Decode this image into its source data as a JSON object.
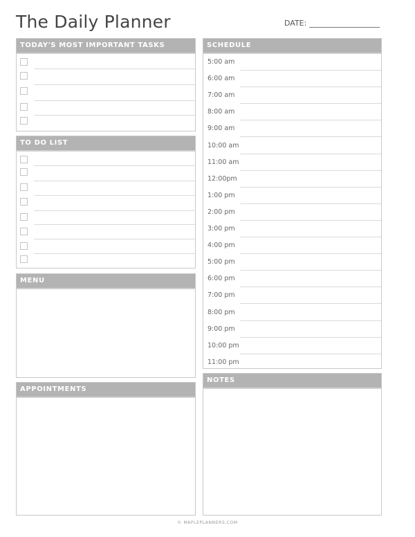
{
  "header": {
    "title": "The Daily Planner",
    "date_label": "DATE:"
  },
  "sections": {
    "tasks": {
      "title": "TODAY'S MOST IMPORTANT TASKS",
      "item_count": 5
    },
    "todo": {
      "title": "TO DO LIST",
      "item_count": 8
    },
    "menu": {
      "title": "MENU"
    },
    "appointments": {
      "title": "APPOINTMENTS"
    },
    "schedule": {
      "title": "SCHEDULE",
      "times": [
        "5:00 am",
        "6:00 am",
        "7:00 am",
        "8:00 am",
        "9:00 am",
        "10:00 am",
        "11:00 am",
        "12:00pm",
        "1:00 pm",
        "2:00 pm",
        "3:00 pm",
        "4:00 pm",
        "5:00 pm",
        "6:00 pm",
        "7:00 pm",
        "8:00 pm",
        "9:00 pm",
        "10:00 pm",
        "11:00 pm"
      ]
    },
    "notes": {
      "title": "NOTES"
    }
  },
  "footer": {
    "text": "© MAPLEPLANNERS.COM"
  },
  "colors": {
    "header_bg": "#b3b3b3",
    "border": "#c8c8c8",
    "rule": "#dadada"
  }
}
